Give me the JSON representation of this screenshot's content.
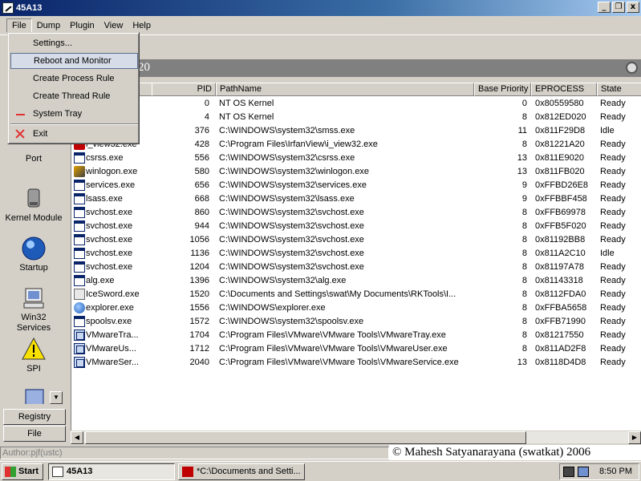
{
  "window": {
    "title": "45A13",
    "controls": [
      "_",
      "❐",
      "x"
    ]
  },
  "menubar": [
    "File",
    "Dump",
    "Plugin",
    "View",
    "Help"
  ],
  "file_menu": {
    "items": [
      {
        "label": "Settings...",
        "icon": "none"
      },
      {
        "label": "Reboot and Monitor",
        "icon": "none",
        "highlighted": true
      },
      {
        "label": "Create Process Rule",
        "icon": "none"
      },
      {
        "label": "Create Thread Rule",
        "icon": "none"
      },
      {
        "label": "System Tray",
        "icon": "tray-icon"
      },
      {
        "label": "Exit",
        "icon": "exit-x-icon"
      }
    ]
  },
  "header": {
    "partial_text": "20"
  },
  "leftnav": {
    "items": [
      {
        "label": "Port",
        "icon": "port-icon"
      },
      {
        "label": "Kernel Module",
        "icon": "kernel-module-icon"
      },
      {
        "label": "Startup",
        "icon": "startup-icon"
      },
      {
        "label": "Win32 Services",
        "icon": "win32-services-icon"
      },
      {
        "label": "SPI",
        "icon": "warning-icon"
      }
    ],
    "bottom_buttons": [
      "Registry",
      "File"
    ]
  },
  "table": {
    "columns": [
      "",
      "PID",
      "PathName",
      "Base Priority",
      "EPROCESS",
      "State"
    ],
    "rows": [
      {
        "name": "",
        "icon": "none",
        "pid": "0",
        "path": "NT OS Kernel",
        "prio": "0",
        "eprocess": "0x80559580",
        "state": "Ready"
      },
      {
        "name": "",
        "icon": "none",
        "pid": "4",
        "path": "NT OS Kernel",
        "prio": "8",
        "eprocess": "0x812ED020",
        "state": "Ready"
      },
      {
        "name": "",
        "icon": "none",
        "pid": "376",
        "path": "C:\\WINDOWS\\system32\\smss.exe",
        "prio": "11",
        "eprocess": "0x811F29D8",
        "state": "Idle"
      },
      {
        "name": "i_view32.exe",
        "icon": "red",
        "pid": "428",
        "path": "C:\\Program Files\\IrfanView\\i_view32.exe",
        "prio": "8",
        "eprocess": "0x81221A20",
        "state": "Ready"
      },
      {
        "name": "csrss.exe",
        "icon": "window",
        "pid": "556",
        "path": "C:\\WINDOWS\\system32\\csrss.exe",
        "prio": "13",
        "eprocess": "0x811E9020",
        "state": "Ready"
      },
      {
        "name": "winlogon.exe",
        "icon": "win",
        "pid": "580",
        "path": "C:\\WINDOWS\\system32\\winlogon.exe",
        "prio": "13",
        "eprocess": "0x811FB020",
        "state": "Ready"
      },
      {
        "name": "services.exe",
        "icon": "window",
        "pid": "656",
        "path": "C:\\WINDOWS\\system32\\services.exe",
        "prio": "9",
        "eprocess": "0xFFBD26E8",
        "state": "Ready"
      },
      {
        "name": "lsass.exe",
        "icon": "window",
        "pid": "668",
        "path": "C:\\WINDOWS\\system32\\lsass.exe",
        "prio": "9",
        "eprocess": "0xFFBBF458",
        "state": "Ready"
      },
      {
        "name": "svchost.exe",
        "icon": "window",
        "pid": "860",
        "path": "C:\\WINDOWS\\system32\\svchost.exe",
        "prio": "8",
        "eprocess": "0xFFB69978",
        "state": "Ready"
      },
      {
        "name": "svchost.exe",
        "icon": "window",
        "pid": "944",
        "path": "C:\\WINDOWS\\system32\\svchost.exe",
        "prio": "8",
        "eprocess": "0xFFB5F020",
        "state": "Ready"
      },
      {
        "name": "svchost.exe",
        "icon": "window",
        "pid": "1056",
        "path": "C:\\WINDOWS\\system32\\svchost.exe",
        "prio": "8",
        "eprocess": "0x81192BB8",
        "state": "Ready"
      },
      {
        "name": "svchost.exe",
        "icon": "window",
        "pid": "1136",
        "path": "C:\\WINDOWS\\system32\\svchost.exe",
        "prio": "8",
        "eprocess": "0x811A2C10",
        "state": "Idle"
      },
      {
        "name": "svchost.exe",
        "icon": "window",
        "pid": "1204",
        "path": "C:\\WINDOWS\\system32\\svchost.exe",
        "prio": "8",
        "eprocess": "0x81197A78",
        "state": "Ready"
      },
      {
        "name": "alg.exe",
        "icon": "window",
        "pid": "1396",
        "path": "C:\\WINDOWS\\system32\\alg.exe",
        "prio": "8",
        "eprocess": "0x81143318",
        "state": "Ready"
      },
      {
        "name": "IceSword.exe",
        "icon": "sword",
        "pid": "1520",
        "path": "C:\\Documents and Settings\\swat\\My Documents\\RKTools\\I...",
        "prio": "8",
        "eprocess": "0x8112FDA0",
        "state": "Ready"
      },
      {
        "name": "explorer.exe",
        "icon": "globe",
        "pid": "1556",
        "path": "C:\\WINDOWS\\explorer.exe",
        "prio": "8",
        "eprocess": "0xFFBA5658",
        "state": "Ready"
      },
      {
        "name": "spoolsv.exe",
        "icon": "window",
        "pid": "1572",
        "path": "C:\\WINDOWS\\system32\\spoolsv.exe",
        "prio": "8",
        "eprocess": "0xFFB71990",
        "state": "Ready"
      },
      {
        "name": "VMwareTra...",
        "icon": "vm",
        "pid": "1704",
        "path": "C:\\Program Files\\VMware\\VMware Tools\\VMwareTray.exe",
        "prio": "8",
        "eprocess": "0x81217550",
        "state": "Ready"
      },
      {
        "name": "VMwareUs...",
        "icon": "vm",
        "pid": "1712",
        "path": "C:\\Program Files\\VMware\\VMware Tools\\VMwareUser.exe",
        "prio": "8",
        "eprocess": "0x811AD2F8",
        "state": "Ready"
      },
      {
        "name": "VMwareSer...",
        "icon": "vm",
        "pid": "2040",
        "path": "C:\\Program Files\\VMware\\VMware Tools\\VMwareService.exe",
        "prio": "13",
        "eprocess": "0x8118D4D8",
        "state": "Ready"
      }
    ]
  },
  "statusbar": {
    "author": "Author:pjf(ustc)",
    "copyright": "© Mahesh Satyanarayana (swatkat) 2006"
  },
  "taskbar": {
    "start_label": "Start",
    "tasks": [
      {
        "label": "45A13",
        "active": true
      },
      {
        "label": "*C:\\Documents and Setti...",
        "active": false
      }
    ],
    "clock": "8:50 PM"
  },
  "colors": {
    "title_bar": "#0a246a",
    "header_strip": "#808080",
    "menu_highlight": "#d6dce8"
  }
}
